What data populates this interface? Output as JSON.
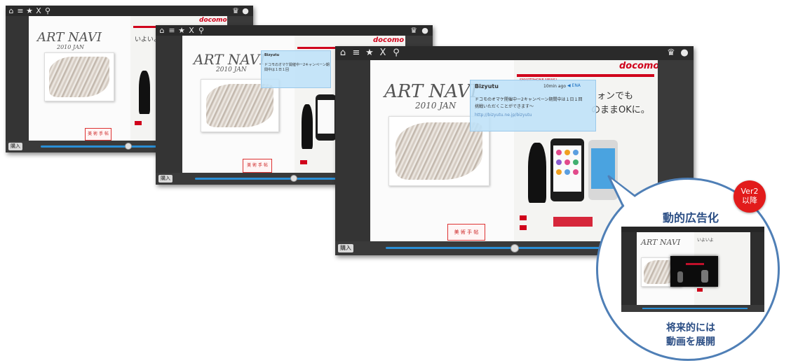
{
  "toolbar": {
    "home_icon": "home-icon",
    "list_icon": "list-icon",
    "star_icon": "star-icon",
    "close_symbol": "X",
    "search_icon": "search-icon",
    "crown_icon": "crown-icon",
    "chat_icon": "speech-bubble-icon"
  },
  "book": {
    "title_line1": "ART NAVI",
    "title_line2": "2010 JAN",
    "buy_label": "購入",
    "stamp_text": "美 術 手 帖"
  },
  "ad_page": {
    "brand": "docomo",
    "headline_right": "ォンでも",
    "headline_right2": "のままOKに。",
    "small_header": "SMARTPHONE NEWS!",
    "headline_left": "いよいよ"
  },
  "tooltip": {
    "user": "Bizyutu",
    "time": "10min ago",
    "badge": "◀ ENA",
    "text_line1": "ドコモのオマケ開催中ー2キャンペーン期間中は１日１回",
    "text_line2": "挑戦いただくことができます～",
    "link": "http://bizyutu.ne.jp/bizyutu"
  },
  "callout": {
    "version_line1": "Ver2",
    "version_line2": "以降",
    "title": "動的広告化",
    "footer_line1": "将来的には",
    "footer_line2": "動画を展開"
  },
  "progress": {
    "screen1": 0.6,
    "screen2": 0.65,
    "screen3": 0.38
  },
  "colors": {
    "accent_blue": "#2a8fd6",
    "docomo_red": "#d0021b",
    "badge_red": "#e21b1b",
    "callout_border": "#4f7fb6"
  }
}
